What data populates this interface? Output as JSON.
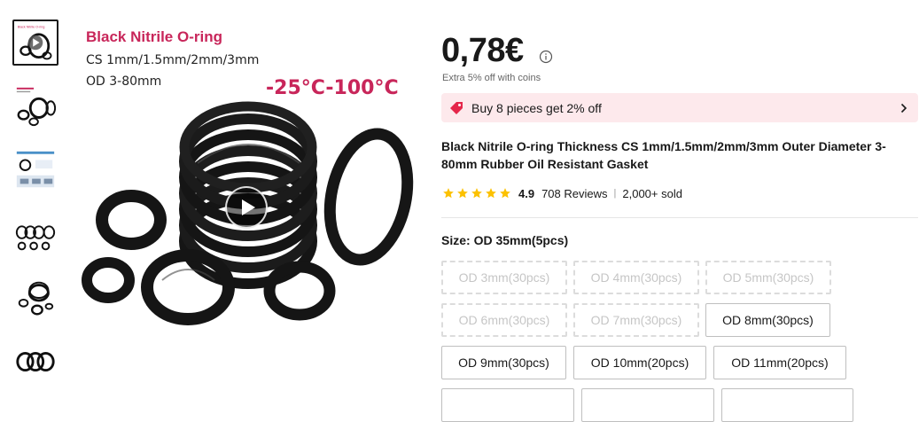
{
  "gallery": {
    "image_text": {
      "title": "Black Nitrile O-ring",
      "cs": "CS 1mm/1.5mm/2mm/3mm",
      "od": "OD 3-80mm",
      "temperature": "-25°C-100°C"
    },
    "thumb_text": "Black Nitrile O-ring"
  },
  "product": {
    "price": "0,78€",
    "coins_note": "Extra 5% off with coins",
    "promo": "Buy 8 pieces get 2% off",
    "title": "Black Nitrile O-ring Thickness CS 1mm/1.5mm/2mm/3mm Outer Diameter 3-80mm Rubber Oil Resistant Gasket",
    "rating": {
      "score": "4.9",
      "stars": 5,
      "reviews": "708 Reviews",
      "separator": "|",
      "sold": "2,000+ sold"
    },
    "size": {
      "label": "Size: OD 35mm(5pcs)",
      "options": [
        {
          "label": "OD 3mm(30pcs)",
          "state": "disabled"
        },
        {
          "label": "OD 4mm(30pcs)",
          "state": "disabled"
        },
        {
          "label": "OD 5mm(30pcs)",
          "state": "disabled"
        },
        {
          "label": "OD 6mm(30pcs)",
          "state": "disabled"
        },
        {
          "label": "OD 7mm(30pcs)",
          "state": "disabled"
        },
        {
          "label": "OD 8mm(30pcs)",
          "state": "available"
        },
        {
          "label": "OD 9mm(30pcs)",
          "state": "available"
        },
        {
          "label": "OD 10mm(20pcs)",
          "state": "available"
        },
        {
          "label": "OD 11mm(20pcs)",
          "state": "available"
        }
      ]
    }
  },
  "colors": {
    "accent": "#c8265a",
    "promo_bg": "#fde9ec",
    "star": "#fcc100",
    "text": "#191919"
  },
  "icons": {
    "info": "info-icon",
    "promo": "tag-icon",
    "chevron": "chevron-right-icon",
    "play": "play-icon",
    "star": "star-icon"
  }
}
